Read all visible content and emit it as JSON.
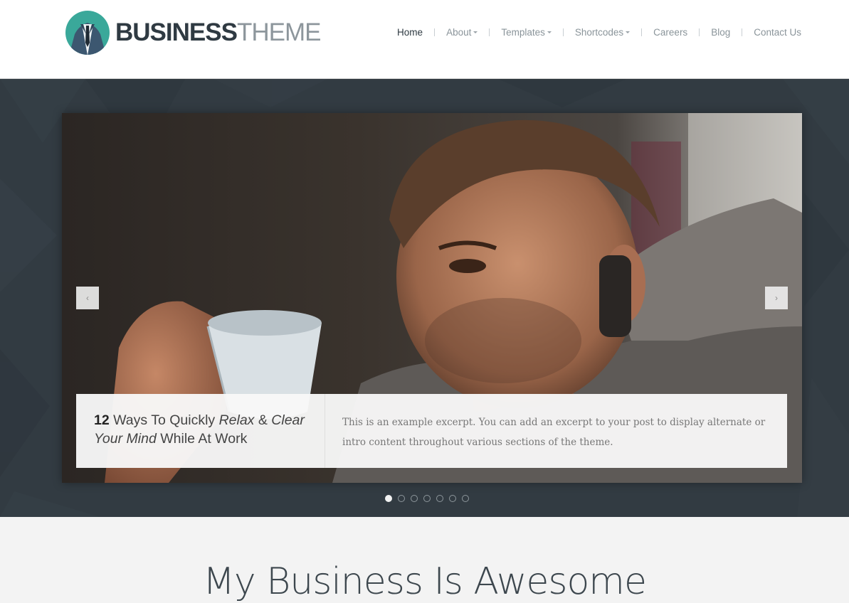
{
  "brand": {
    "name_bold": "BUSINESS",
    "name_light": "THEME"
  },
  "nav": {
    "items": [
      {
        "label": "Home",
        "active": true,
        "dropdown": false
      },
      {
        "label": "About",
        "active": false,
        "dropdown": true
      },
      {
        "label": "Templates",
        "active": false,
        "dropdown": true
      },
      {
        "label": "Shortcodes",
        "active": false,
        "dropdown": true
      },
      {
        "label": "Careers",
        "active": false,
        "dropdown": false
      },
      {
        "label": "Blog",
        "active": false,
        "dropdown": false
      },
      {
        "label": "Contact Us",
        "active": false,
        "dropdown": false
      }
    ]
  },
  "slider": {
    "prev_label": "‹",
    "next_label": "›",
    "caption": {
      "number": "12",
      "t1": " Ways To Quickly ",
      "t2": "Relax",
      "t3": " & ",
      "t4": "Clear",
      "t5": "Your Mind",
      "t6": " While At Work",
      "excerpt": "This is an example excerpt. You can add an excerpt to your post to display alternate or intro content throughout various sections of the theme."
    },
    "slide_count": 7,
    "active_slide": 1
  },
  "section": {
    "title": "My Business Is Awesome"
  },
  "colors": {
    "accent": "#3aa89a",
    "hero_bg": "#323b42",
    "nav_active": "#2e3a42"
  }
}
